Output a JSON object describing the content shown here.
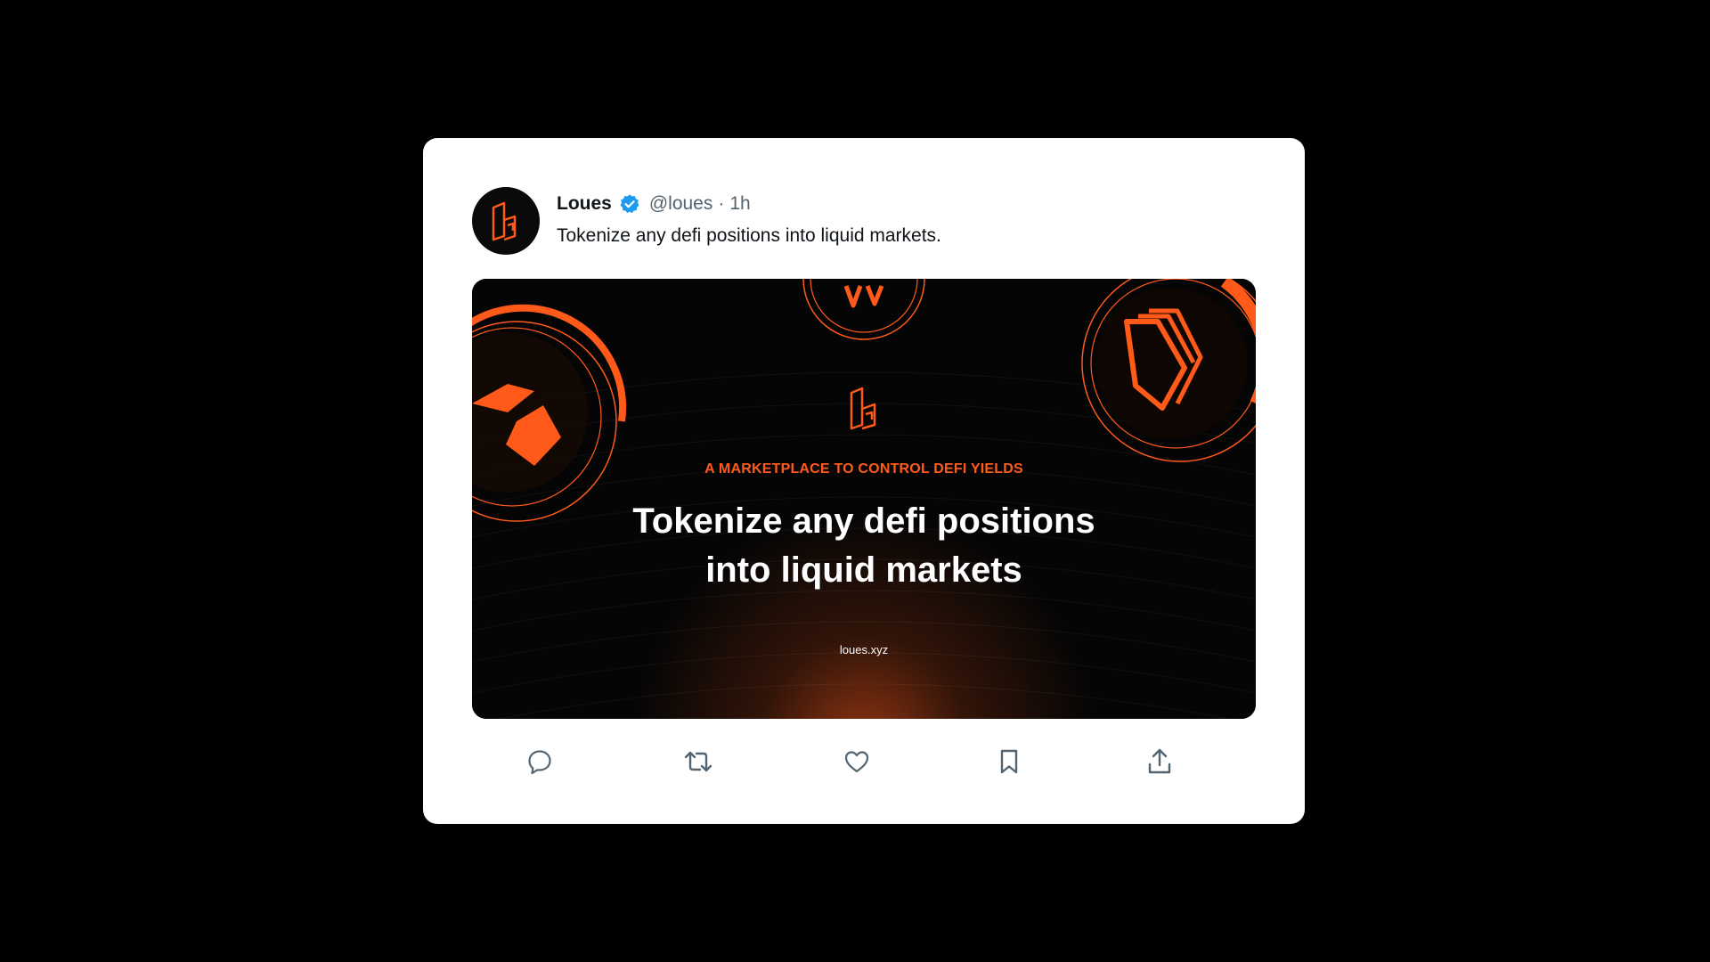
{
  "tweet": {
    "author_name": "Loues",
    "handle": "@loues",
    "separator": "·",
    "time": "1h",
    "verified": true,
    "text": "Tokenize any defi positions into liquid markets."
  },
  "media": {
    "eyebrow": "A MARKETPLACE TO CONTROL DEFI YIELDS",
    "headline_line1": "Tokenize any defi positions",
    "headline_line2": "into liquid markets",
    "url": "loues.xyz"
  },
  "actions": [
    {
      "icon": "reply-icon"
    },
    {
      "icon": "retweet-icon"
    },
    {
      "icon": "like-icon"
    },
    {
      "icon": "bookmark-icon"
    },
    {
      "icon": "share-icon"
    }
  ],
  "colors": {
    "brand_orange": "#ff5a1a",
    "verified_blue": "#1d9bf0",
    "text_primary": "#0f1419",
    "text_secondary": "#536471",
    "page_background": "#000000",
    "card_background": "#ffffff"
  }
}
